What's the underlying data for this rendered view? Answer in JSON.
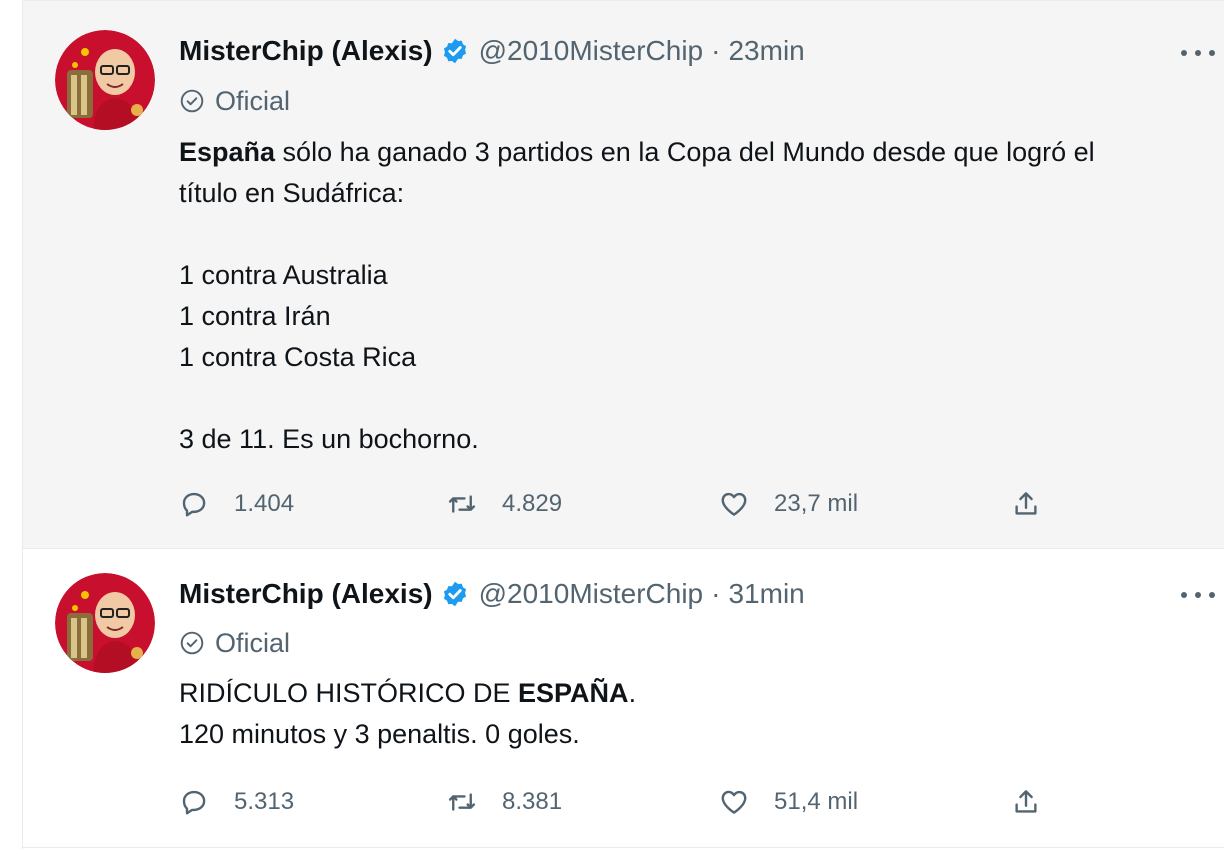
{
  "colors": {
    "accent": "#1d9bf0",
    "text": "#0f1419",
    "muted": "#536471",
    "highlight_bg": "#f5f5f5"
  },
  "tweets": [
    {
      "author_name": "MisterChip (Alexis)",
      "handle": "@2010MisterChip",
      "separator": "·",
      "time": "23min",
      "label": "Oficial",
      "body": {
        "line1_bold": "España",
        "line1_rest": " sólo ha ganado 3 partidos en la Copa del Mundo desde que logró el",
        "line2": "título en Sudáfrica:",
        "list": [
          "1 contra Australia",
          "1 contra Irán",
          "1 contra Costa Rica"
        ],
        "closing": "3 de 11. Es un bochorno."
      },
      "stats": {
        "replies": "1.404",
        "retweets": "4.829",
        "likes": "23,7 mil"
      },
      "icons": [
        "verified-badge-icon",
        "official-check-icon",
        "reply-icon",
        "retweet-icon",
        "like-icon",
        "share-icon",
        "more-icon"
      ]
    },
    {
      "author_name": "MisterChip (Alexis)",
      "handle": "@2010MisterChip",
      "separator": "·",
      "time": "31min",
      "label": "Oficial",
      "body": {
        "line1_pre": "RIDÍCULO HISTÓRICO DE ",
        "line1_bold": "ESPAÑA",
        "line1_post": ".",
        "line2": "120 minutos y 3 penaltis. 0 goles."
      },
      "stats": {
        "replies": "5.313",
        "retweets": "8.381",
        "likes": "51,4 mil"
      },
      "icons": [
        "verified-badge-icon",
        "official-check-icon",
        "reply-icon",
        "retweet-icon",
        "like-icon",
        "share-icon",
        "more-icon"
      ]
    }
  ]
}
